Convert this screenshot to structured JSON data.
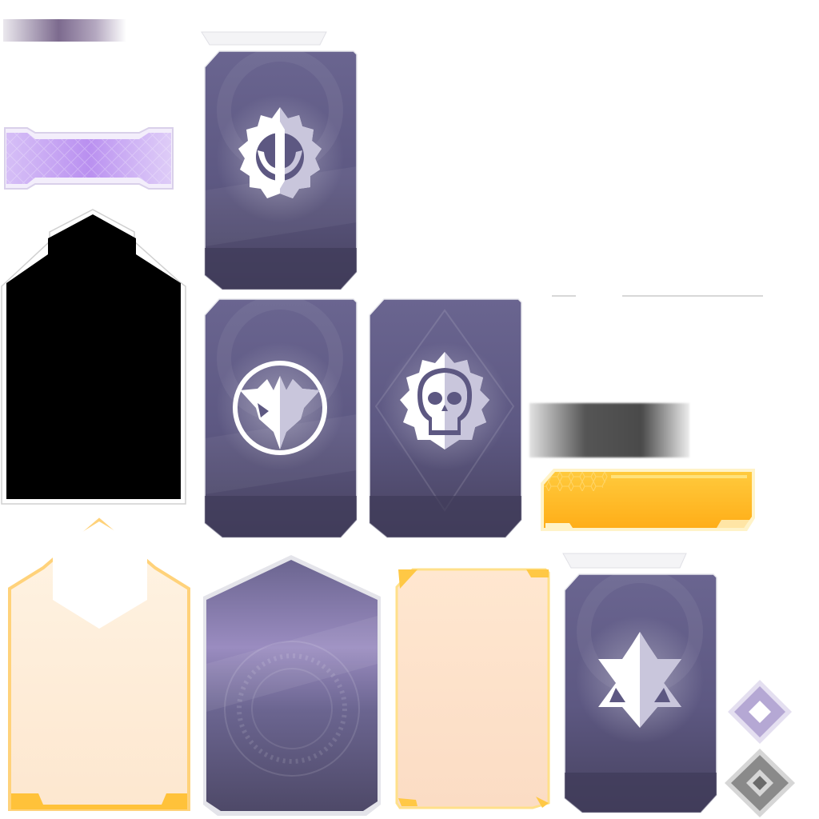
{
  "sheet": {
    "kind": "game-ui-sprite-atlas",
    "colors": {
      "card_purple": "#5d5882",
      "card_purple_dark": "#3e3a59",
      "card_purple_light": "#7f79a6",
      "emblem_white": "#ffffff",
      "emblem_shade": "#c9c6dc",
      "lavender_glow": "#b996f0",
      "gold": "#ffb21f",
      "gold_light": "#ffd66b",
      "cream": "#fdebd6",
      "peach": "#fbdcc4",
      "gray_bar": "#555555",
      "black_frame": "#000000"
    },
    "sprites": [
      {
        "id": "faction-card-gear-blade",
        "icon": "gear-blade-emblem-icon"
      },
      {
        "id": "faction-card-chevron-circle",
        "icon": "chevron-circle-emblem-icon"
      },
      {
        "id": "faction-card-skull-gear",
        "icon": "skull-gear-emblem-icon"
      },
      {
        "id": "faction-card-star-emblem",
        "icon": "star-emblem-icon"
      },
      {
        "id": "empty-card-purple",
        "icon": "ornate-circle-pattern-icon"
      },
      {
        "id": "gold-glow-card",
        "icon": "hexagon-glow-icon"
      },
      {
        "id": "peach-card",
        "icon": "corner-bracket-icon"
      },
      {
        "id": "gold-banner-bar",
        "icon": "hex-pattern-icon"
      },
      {
        "id": "lavender-ribbon-bar",
        "icon": "diamond-mesh-icon"
      },
      {
        "id": "black-silhouette-frame",
        "icon": "hexagon-top-frame-icon"
      },
      {
        "id": "diamond-gem-purple",
        "icon": "diamond-gem-icon"
      },
      {
        "id": "diamond-gem-gray",
        "icon": "diamond-gem-icon"
      }
    ]
  }
}
